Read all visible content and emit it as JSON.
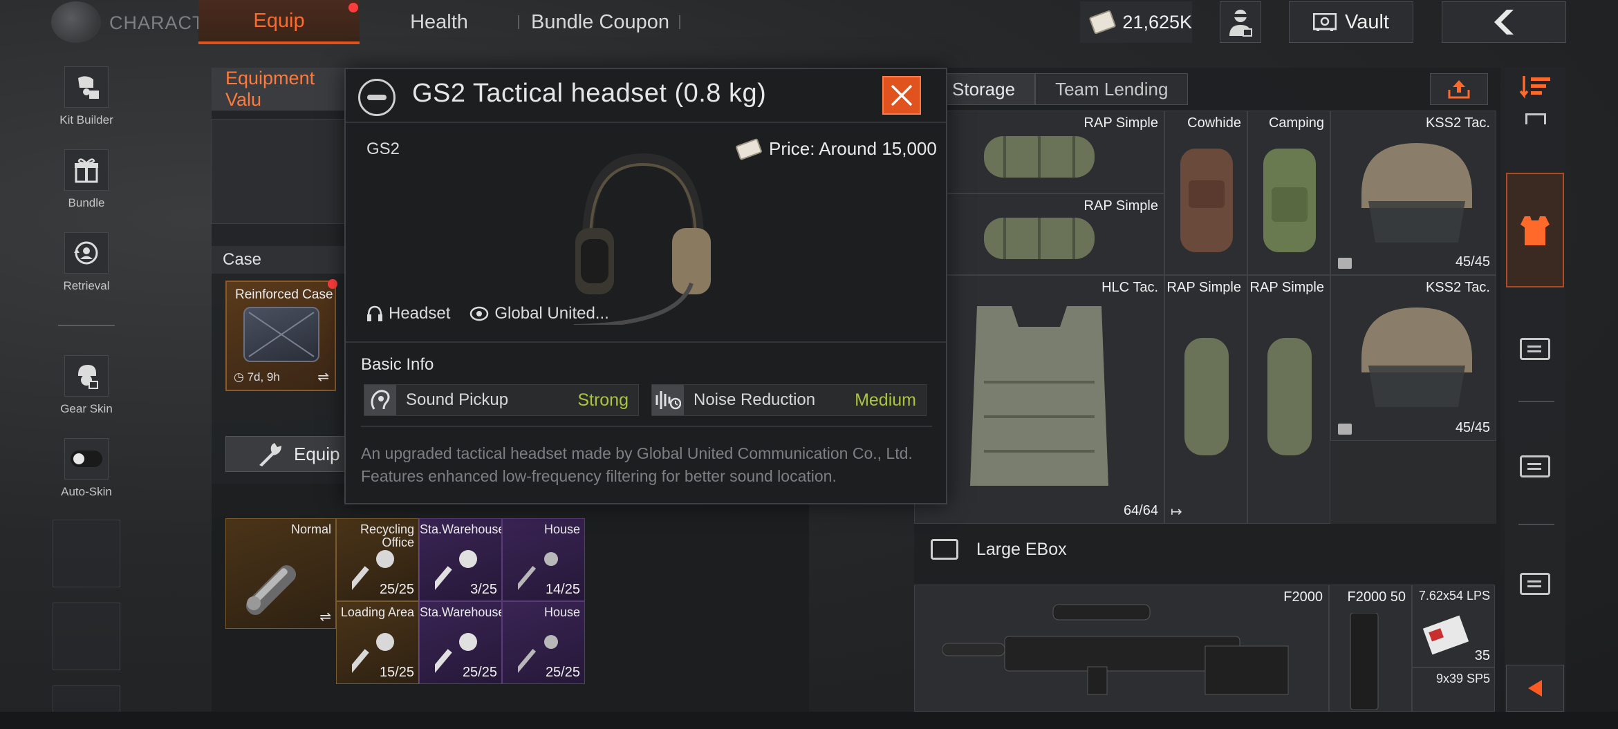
{
  "topbar": {
    "section_label": "CHARACTER",
    "tabs": [
      {
        "label": "Equip",
        "active": true,
        "has_alert": true
      },
      {
        "label": "Health",
        "active": false
      },
      {
        "label": "Bundle Coupon",
        "active": false
      }
    ],
    "currency": "21,625K",
    "vault_label": "Vault"
  },
  "sidebar": {
    "items": [
      {
        "label": "Kit Builder",
        "icon": "kit-builder-icon"
      },
      {
        "label": "Bundle",
        "icon": "gift-icon"
      },
      {
        "label": "Retrieval",
        "icon": "retrieval-icon"
      },
      {
        "label": "Gear Skin",
        "icon": "gear-skin-icon"
      },
      {
        "label": "Auto-Skin",
        "icon": "toggle-icon"
      }
    ]
  },
  "equip_panel": {
    "value_label": "Equipment Valu",
    "case_header": "Case",
    "case_card": {
      "title": "Reinforced Case",
      "time": "7d, 9h"
    },
    "equip_button": "Equip"
  },
  "keys": [
    {
      "label": "Normal",
      "count": "",
      "rarity": "gold"
    },
    {
      "label": "Recycling Office",
      "count": "25/25",
      "rarity": "gold"
    },
    {
      "label": "Sta.Warehouse",
      "count": "3/25",
      "rarity": "purple"
    },
    {
      "label": "House",
      "count": "14/25",
      "rarity": "purple"
    },
    {
      "label": "Loading Area",
      "count": "15/25",
      "rarity": "gold"
    },
    {
      "label": "Sta.Warehouse",
      "count": "25/25",
      "rarity": "purple"
    },
    {
      "label": "House",
      "count": "25/25",
      "rarity": "purple"
    }
  ],
  "storage": {
    "tabs": [
      "Storage",
      "Team Lending"
    ],
    "items": [
      {
        "label": "RAP Simple",
        "count": ""
      },
      {
        "label": "RAP Simple",
        "count": ""
      },
      {
        "label": "Cowhide",
        "count": ""
      },
      {
        "label": "Camping",
        "count": ""
      },
      {
        "label": "KSS2 Tac.",
        "count": "45/45"
      },
      {
        "label": "HLC Tac.",
        "count": "64/64"
      },
      {
        "label": "RAP Simple",
        "count": ""
      },
      {
        "label": "RAP Simple",
        "count": ""
      },
      {
        "label": "KSS2 Tac.",
        "count": "45/45"
      }
    ],
    "ebox_label": "Large EBox",
    "ebox_items": [
      {
        "label": "F2000",
        "count": ""
      },
      {
        "label": "F2000 50",
        "count": ""
      },
      {
        "label": "7.62x54 LPS",
        "count": "35"
      },
      {
        "label": "9x39 SP5",
        "count": ""
      }
    ]
  },
  "modal": {
    "title": "GS2 Tactical headset (0.8 kg)",
    "code": "GS2",
    "price": "Price: Around 15,000",
    "tags": [
      "Headset",
      "Global United..."
    ],
    "basic_info_label": "Basic Info",
    "stats": [
      {
        "name": "Sound Pickup",
        "value": "Strong"
      },
      {
        "name": "Noise Reduction",
        "value": "Medium"
      }
    ],
    "description_line1": "An upgraded tactical headset made by Global United Communication Co., Ltd.",
    "description_line2": "Features enhanced low-frequency filtering for better sound location."
  },
  "colors": {
    "accent": "#e0521e",
    "stat_value": "#a8c540",
    "rarity_gold": "#7a5a2a",
    "rarity_purple": "#5a3a7a"
  }
}
